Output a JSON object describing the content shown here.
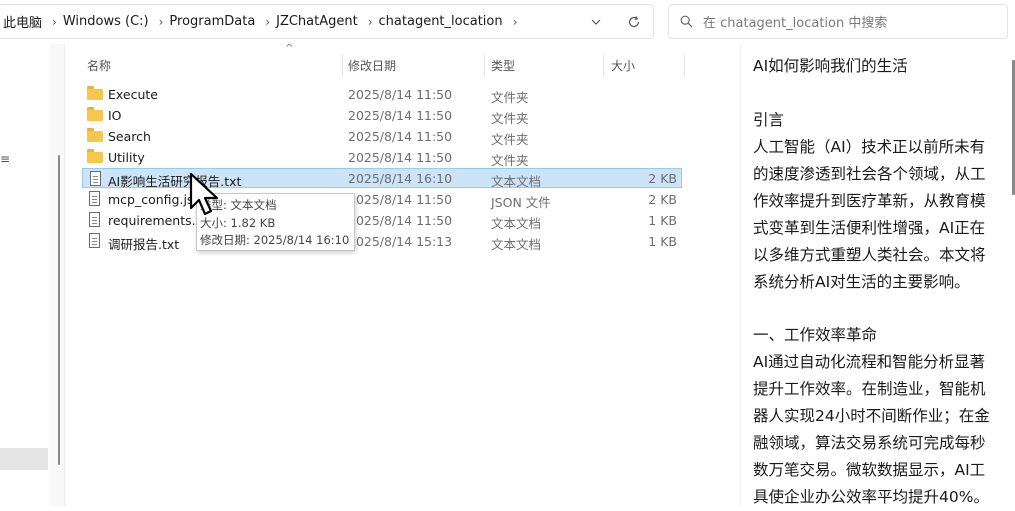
{
  "address_bar": {
    "crumbs": [
      "此电脑",
      "Windows (C:)",
      "ProgramData",
      "JZChatAgent",
      "chatagent_location"
    ],
    "separator": "›"
  },
  "search": {
    "placeholder": "在 chatagent_location 中搜索"
  },
  "columns": {
    "name": "名称",
    "date": "修改日期",
    "type": "类型",
    "size": "大小"
  },
  "files": [
    {
      "name": "Execute",
      "date": "2025/8/14 11:50",
      "type": "文件夹",
      "size": "",
      "icon": "folder-icon"
    },
    {
      "name": "IO",
      "date": "2025/8/14 11:50",
      "type": "文件夹",
      "size": "",
      "icon": "folder-icon"
    },
    {
      "name": "Search",
      "date": "2025/8/14 11:50",
      "type": "文件夹",
      "size": "",
      "icon": "folder-icon"
    },
    {
      "name": "Utility",
      "date": "2025/8/14 11:50",
      "type": "文件夹",
      "size": "",
      "icon": "folder-icon"
    },
    {
      "name": "AI影响生活研究报告.txt",
      "date": "2025/8/14 16:10",
      "type": "文本文档",
      "size": "2 KB",
      "icon": "text-file-icon",
      "selected": true
    },
    {
      "name": "mcp_config.json",
      "date": "2025/8/14 11:50",
      "type": "JSON 文件",
      "size": "2 KB",
      "icon": "text-file-icon"
    },
    {
      "name": "requirements.txt",
      "date": "2025/8/14 11:50",
      "type": "文本文档",
      "size": "1 KB",
      "icon": "text-file-icon"
    },
    {
      "name": "调研报告.txt",
      "date": "2025/8/14 15:13",
      "type": "文本文档",
      "size": "1 KB",
      "icon": "text-file-icon"
    }
  ],
  "tooltip": {
    "type_line": "类型: 文本文档",
    "size_line": "大小: 1.82 KB",
    "date_line": "修改日期: 2025/8/14 16:10"
  },
  "preview": {
    "title": "AI如何影响我们的生活",
    "intro_heading": "引言",
    "intro_lines": [
      "人工智能（AI）技术正以前所未有",
      "的速度渗透到社会各个领域，从工",
      "作效率提升到医疗革新，从教育模",
      "式变革到生活便利性增强，AI正在",
      "以多维方式重塑人类社会。本文将",
      "系统分析AI对生活的主要影响。"
    ],
    "section1_heading": "一、工作效率革命",
    "section1_lines": [
      "AI通过自动化流程和智能分析显著",
      "提升工作效率。在制造业，智能机",
      "器人实现24小时不间断作业；在金",
      "融领域，算法交易系统可完成每秒",
      "数万笔交易。微软数据显示，AI工",
      "具使企业办公效率平均提升40%。"
    ]
  },
  "colors": {
    "selection": "#cce4f7",
    "folder": "#f5c84c"
  }
}
